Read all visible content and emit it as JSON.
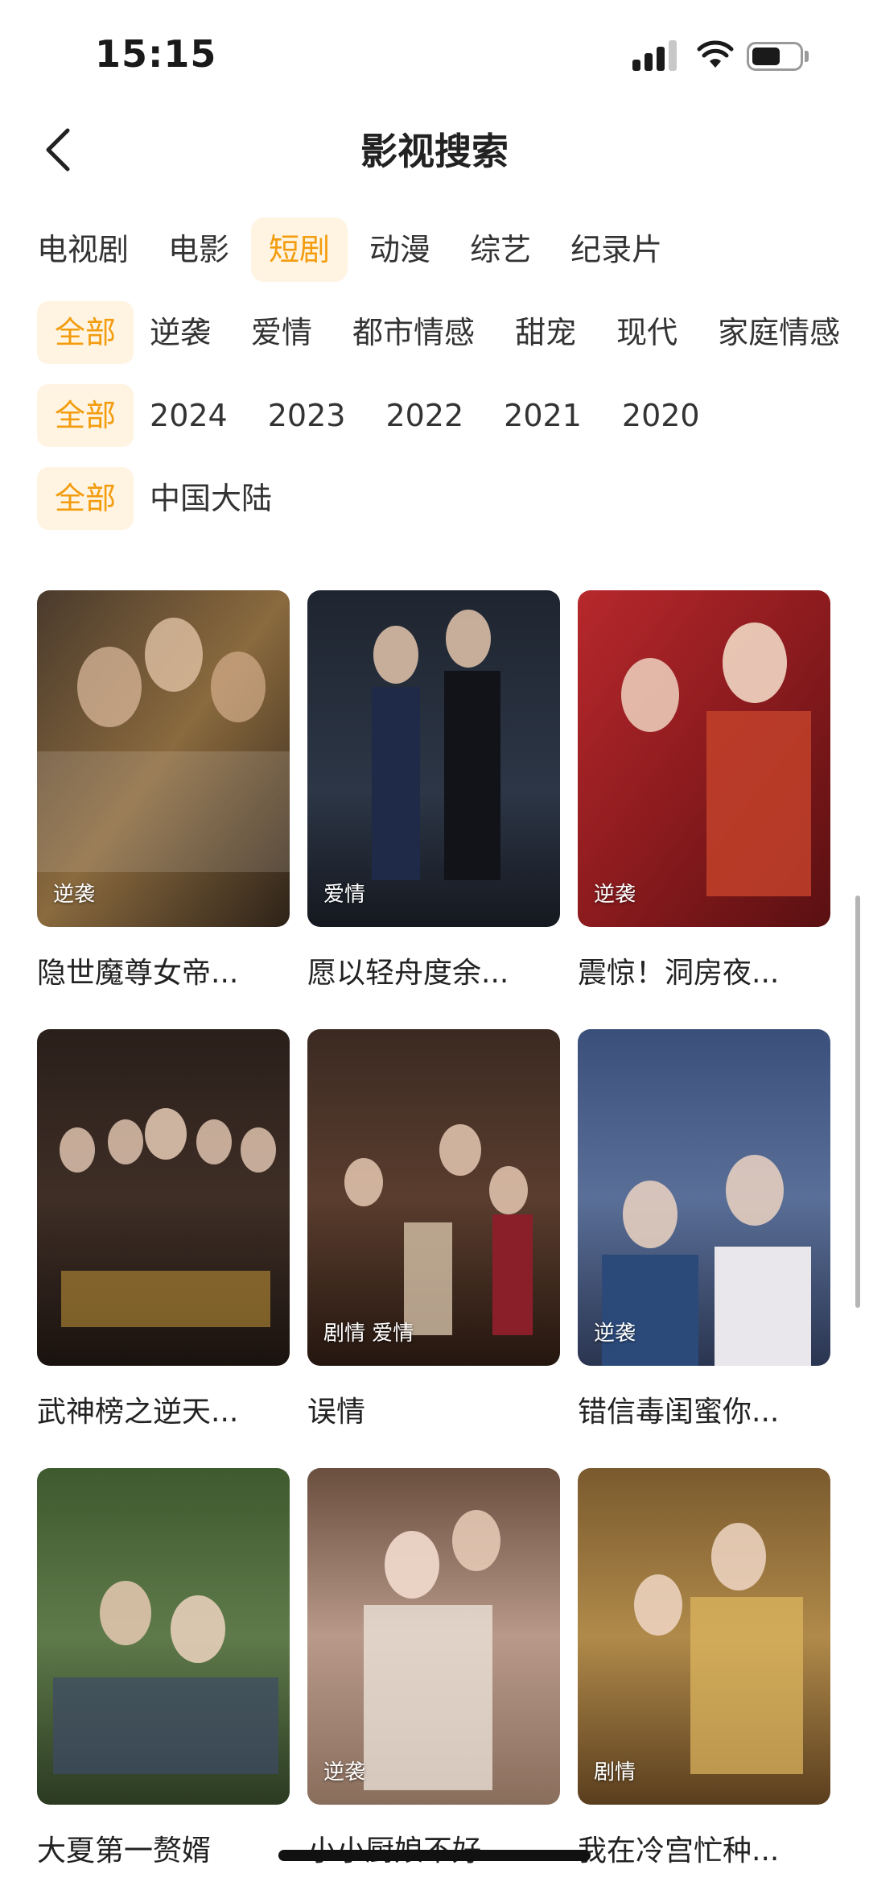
{
  "status": {
    "time": "15:15"
  },
  "nav": {
    "title": "影视搜索"
  },
  "tabs": [
    "电视剧",
    "电影",
    "短剧",
    "动漫",
    "综艺",
    "纪录片"
  ],
  "active_tab": "短剧",
  "filters": {
    "genre": [
      "全部",
      "逆袭",
      "爱情",
      "都市情感",
      "甜宠",
      "现代",
      "家庭情感"
    ],
    "year": [
      "全部",
      "2024",
      "2023",
      "2022",
      "2021",
      "2020"
    ],
    "region": [
      "全部",
      "中国大陆"
    ]
  },
  "cards": [
    {
      "title": "隐世魔尊女帝...",
      "tag": "逆袭"
    },
    {
      "title": "愿以轻舟度余...",
      "tag": "爱情"
    },
    {
      "title": "震惊！洞房夜...",
      "tag": "逆袭"
    },
    {
      "title": "武神榜之逆天...",
      "tag": ""
    },
    {
      "title": "误情",
      "tag": "剧情 爱情"
    },
    {
      "title": "错信毒闺蜜你...",
      "tag": "逆袭"
    },
    {
      "title": "大夏第一赘婿",
      "tag": ""
    },
    {
      "title": "小小厨娘不好...",
      "tag": "逆袭"
    },
    {
      "title": "我在冷宫忙种...",
      "tag": "剧情"
    }
  ],
  "colors": {
    "accent": "#f39c0e",
    "accent_bg": "#fff4e2"
  },
  "icons": {
    "back": "chevron-left-icon",
    "signal": "signal-icon",
    "wifi": "wifi-icon",
    "battery": "battery-icon"
  }
}
